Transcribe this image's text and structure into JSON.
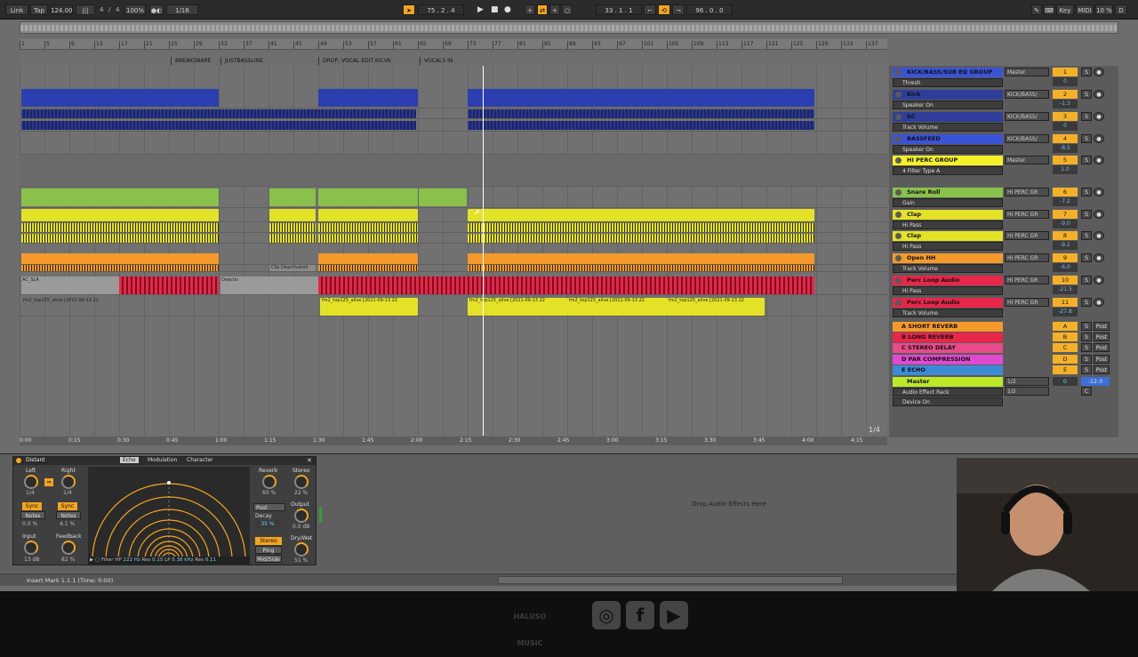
{
  "topbar": {
    "link": "Link",
    "tap": "Tap",
    "tempo": "124.00",
    "meter_num": "4",
    "meter_den": "4",
    "zoom": "100%",
    "quantize": "1/16",
    "position": "75 .  2 .  4",
    "loop_start": "33 .  1 .  1",
    "loop_length": "96 .  0 .  0",
    "key": "Key",
    "midi": "MIDI",
    "cpu": "10 %",
    "d_label": "D"
  },
  "locators": [
    "BREAKSNARE",
    "JUSTBASSLINE",
    "DROP, VOCAL EDIT KICVK",
    "VOCALS IN"
  ],
  "ruler_ticks": [
    "1",
    "5",
    "9",
    "13",
    "17",
    "21",
    "25",
    "29",
    "33",
    "37",
    "41",
    "45",
    "49",
    "53",
    "57",
    "61",
    "65",
    "69",
    "73",
    "77",
    "81",
    "85",
    "89",
    "93",
    "97",
    "101",
    "105",
    "109",
    "113",
    "117",
    "121",
    "125",
    "129",
    "133",
    "137"
  ],
  "time_ticks": [
    "0:00",
    "0:15",
    "0:30",
    "0:45",
    "1:00",
    "1:15",
    "1:30",
    "1:45",
    "2:00",
    "2:15",
    "2:30",
    "2:45",
    "3:00",
    "3:15",
    "3:30",
    "3:45",
    "4:00",
    "4:15"
  ],
  "arrangement": {
    "clip_deactivated": "Clip Deactivated",
    "audio_clip_label": "fm2_top125_alive [2021-09-13 22",
    "small_clip_label": "AC_SLA",
    "deactiv": "Deactiv",
    "page_indicator": "1/4"
  },
  "tracks": [
    {
      "name": "KICK/BASS/SUB EQ GROUP",
      "device": "Thresh",
      "route": "Master",
      "num": "1",
      "vol": "0",
      "color": "#3b54d6"
    },
    {
      "name": "Kick",
      "device": "Speaker On",
      "route": "KICK/BASS/",
      "num": "2",
      "vol": "-1.3",
      "color": "#2e3e9a"
    },
    {
      "name": "SC",
      "device": "Track Volume",
      "route": "KICK/BASS/",
      "num": "3",
      "vol": "0",
      "color": "#2e3e9a"
    },
    {
      "name": "BASSFEED",
      "device": "Speaker On",
      "route": "KICK/BASS/",
      "num": "4",
      "vol": "-8.5",
      "color": "#3b54d6"
    },
    {
      "name": "HI PERC GROUP",
      "device": "4 Filter Type A",
      "route": "Master",
      "num": "5",
      "vol": "1.0",
      "color": "#f4f227"
    },
    {
      "name": "Snare Roll",
      "device": "Gain",
      "route": "HI PERC GR",
      "num": "6",
      "vol": "-7.2",
      "color": "#8ac14b"
    },
    {
      "name": "Clap",
      "device": "Hi Pass",
      "route": "HI PERC GR",
      "num": "7",
      "vol": "-9.0",
      "color": "#e4e227"
    },
    {
      "name": "Clap",
      "device": "Hi Pass",
      "route": "HI PERC GR",
      "num": "8",
      "vol": "-9.2",
      "color": "#e4e227"
    },
    {
      "name": "Open HH",
      "device": "Track Volume",
      "route": "HI PERC GR",
      "num": "9",
      "vol": "-6.0",
      "color": "#f59a2a"
    },
    {
      "name": "Perc Loop Audio",
      "device": "Hi Pass",
      "route": "HI PERC GR",
      "num": "10",
      "vol": "-21.5",
      "color": "#e8264a"
    },
    {
      "name": "Perc Loop Audio",
      "device": "Track Volume",
      "route": "HI PERC GR",
      "num": "11",
      "vol": "-27.8",
      "color": "#e8264a"
    }
  ],
  "returns": [
    {
      "name": "A SHORT REVERB",
      "btn": "A",
      "color": "#f59a2a"
    },
    {
      "name": "B LONG REVERB",
      "btn": "B",
      "color": "#e8264a"
    },
    {
      "name": "C STEREO DELAY",
      "btn": "C",
      "color": "#e84a8a"
    },
    {
      "name": "D PAR COMPRESSION",
      "btn": "D",
      "color": "#e04ad0"
    },
    {
      "name": "E ECHO",
      "btn": "E",
      "color": "#3b8bd6"
    }
  ],
  "master": {
    "name": "Master",
    "device1": "Audio Effect Rack",
    "device2": "Device On",
    "route": "1/2",
    "vol": "0",
    "vol2": "-12.0",
    "color": "#bce827"
  },
  "mixer_labels": {
    "solo": "S",
    "post": "Post",
    "cue": "C"
  },
  "echo": {
    "title": "Distant",
    "tabs": [
      "Echo",
      "Modulation",
      "Character"
    ],
    "left": "Left",
    "right": "Right",
    "left_val": "1/4",
    "right_val": "1/4",
    "sync": "Sync",
    "notes": "Notes",
    "left_offset": "0.0 %",
    "right_offset": "4.1 %",
    "input": "Input",
    "feedback": "Feedback",
    "input_val": "13 dB",
    "feedback_val": "82 %",
    "filter_hp": "Filter HP",
    "hp_freq": "222 Hz",
    "hp_res_label": "Res",
    "hp_res": "0.15",
    "lp_label": "LP",
    "lp_freq": "5.38 kHz",
    "lp_res_label": "Res",
    "lp_res": "0.11",
    "reverb": "Reverb",
    "reverb_val": "60 %",
    "stereo": "Stereo",
    "stereo_val": "22 %",
    "reverb_mode": "Post",
    "decay": "Decay",
    "decay_val": "35 %",
    "output": "Output",
    "output_val": "0.0 dB",
    "mode_stereo": "Stereo",
    "mode_pingpong": "Ping Pong",
    "mode_midside": "Mid/Side",
    "drywet": "Dry/Wet",
    "drywet_val": "51 %"
  },
  "drop_hint": "Drop Audio Effects Here",
  "status": "Insert Mark 1.1.1 (Time: 0:00)",
  "brand": "HALUSO MUSIC"
}
